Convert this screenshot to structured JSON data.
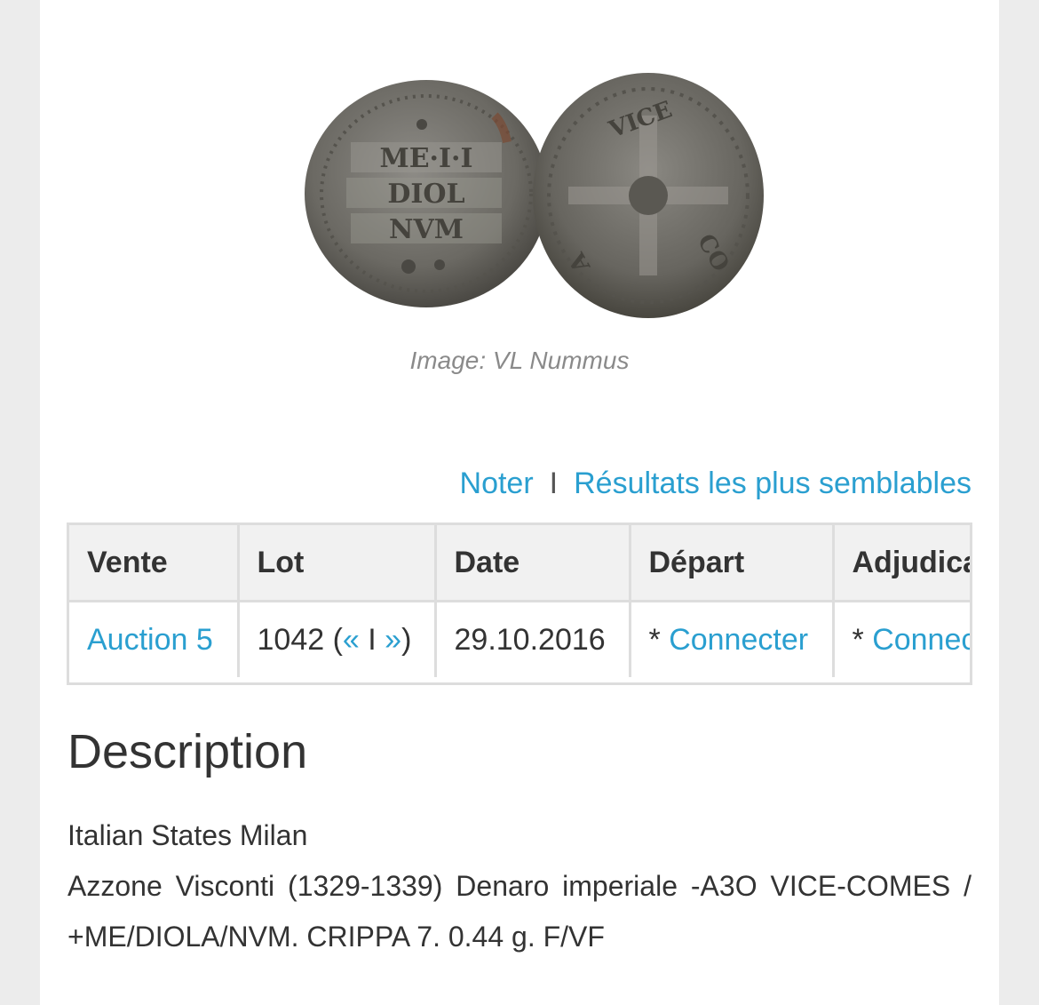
{
  "image": {
    "alt_obverse": "coin-obverse",
    "caption": "Image: VL Nummus"
  },
  "actions": {
    "rate_label": "Noter",
    "separator": "I",
    "similar_label": "Résultats les plus semblables"
  },
  "lot_table": {
    "headers": [
      "Vente",
      "Lot",
      "Date",
      "Départ",
      "Adjudication"
    ],
    "row": {
      "sale": "Auction 5",
      "lot_number": "1042 (",
      "prev": "«",
      "lot_sep": " I ",
      "next": "»",
      "lot_close": ")",
      "date": "29.10.2016",
      "start_prefix": "* ",
      "start_link": "Connecter",
      "hammer_prefix": "* ",
      "hammer_link": "Connecter"
    }
  },
  "description": {
    "title": "Description",
    "line1": "Italian States Milan",
    "line2": "Azzone Visconti (1329-1339) Denaro imperiale -A3O VICE-COMES / +ME/DIOLA/NVM. CRIPPA 7. 0.44 g. F/VF"
  },
  "colors": {
    "link": "#2a9fd0",
    "text": "#333333",
    "header_bg": "#f1f1f1",
    "border": "#dddddd",
    "page_bg": "#ececec"
  }
}
